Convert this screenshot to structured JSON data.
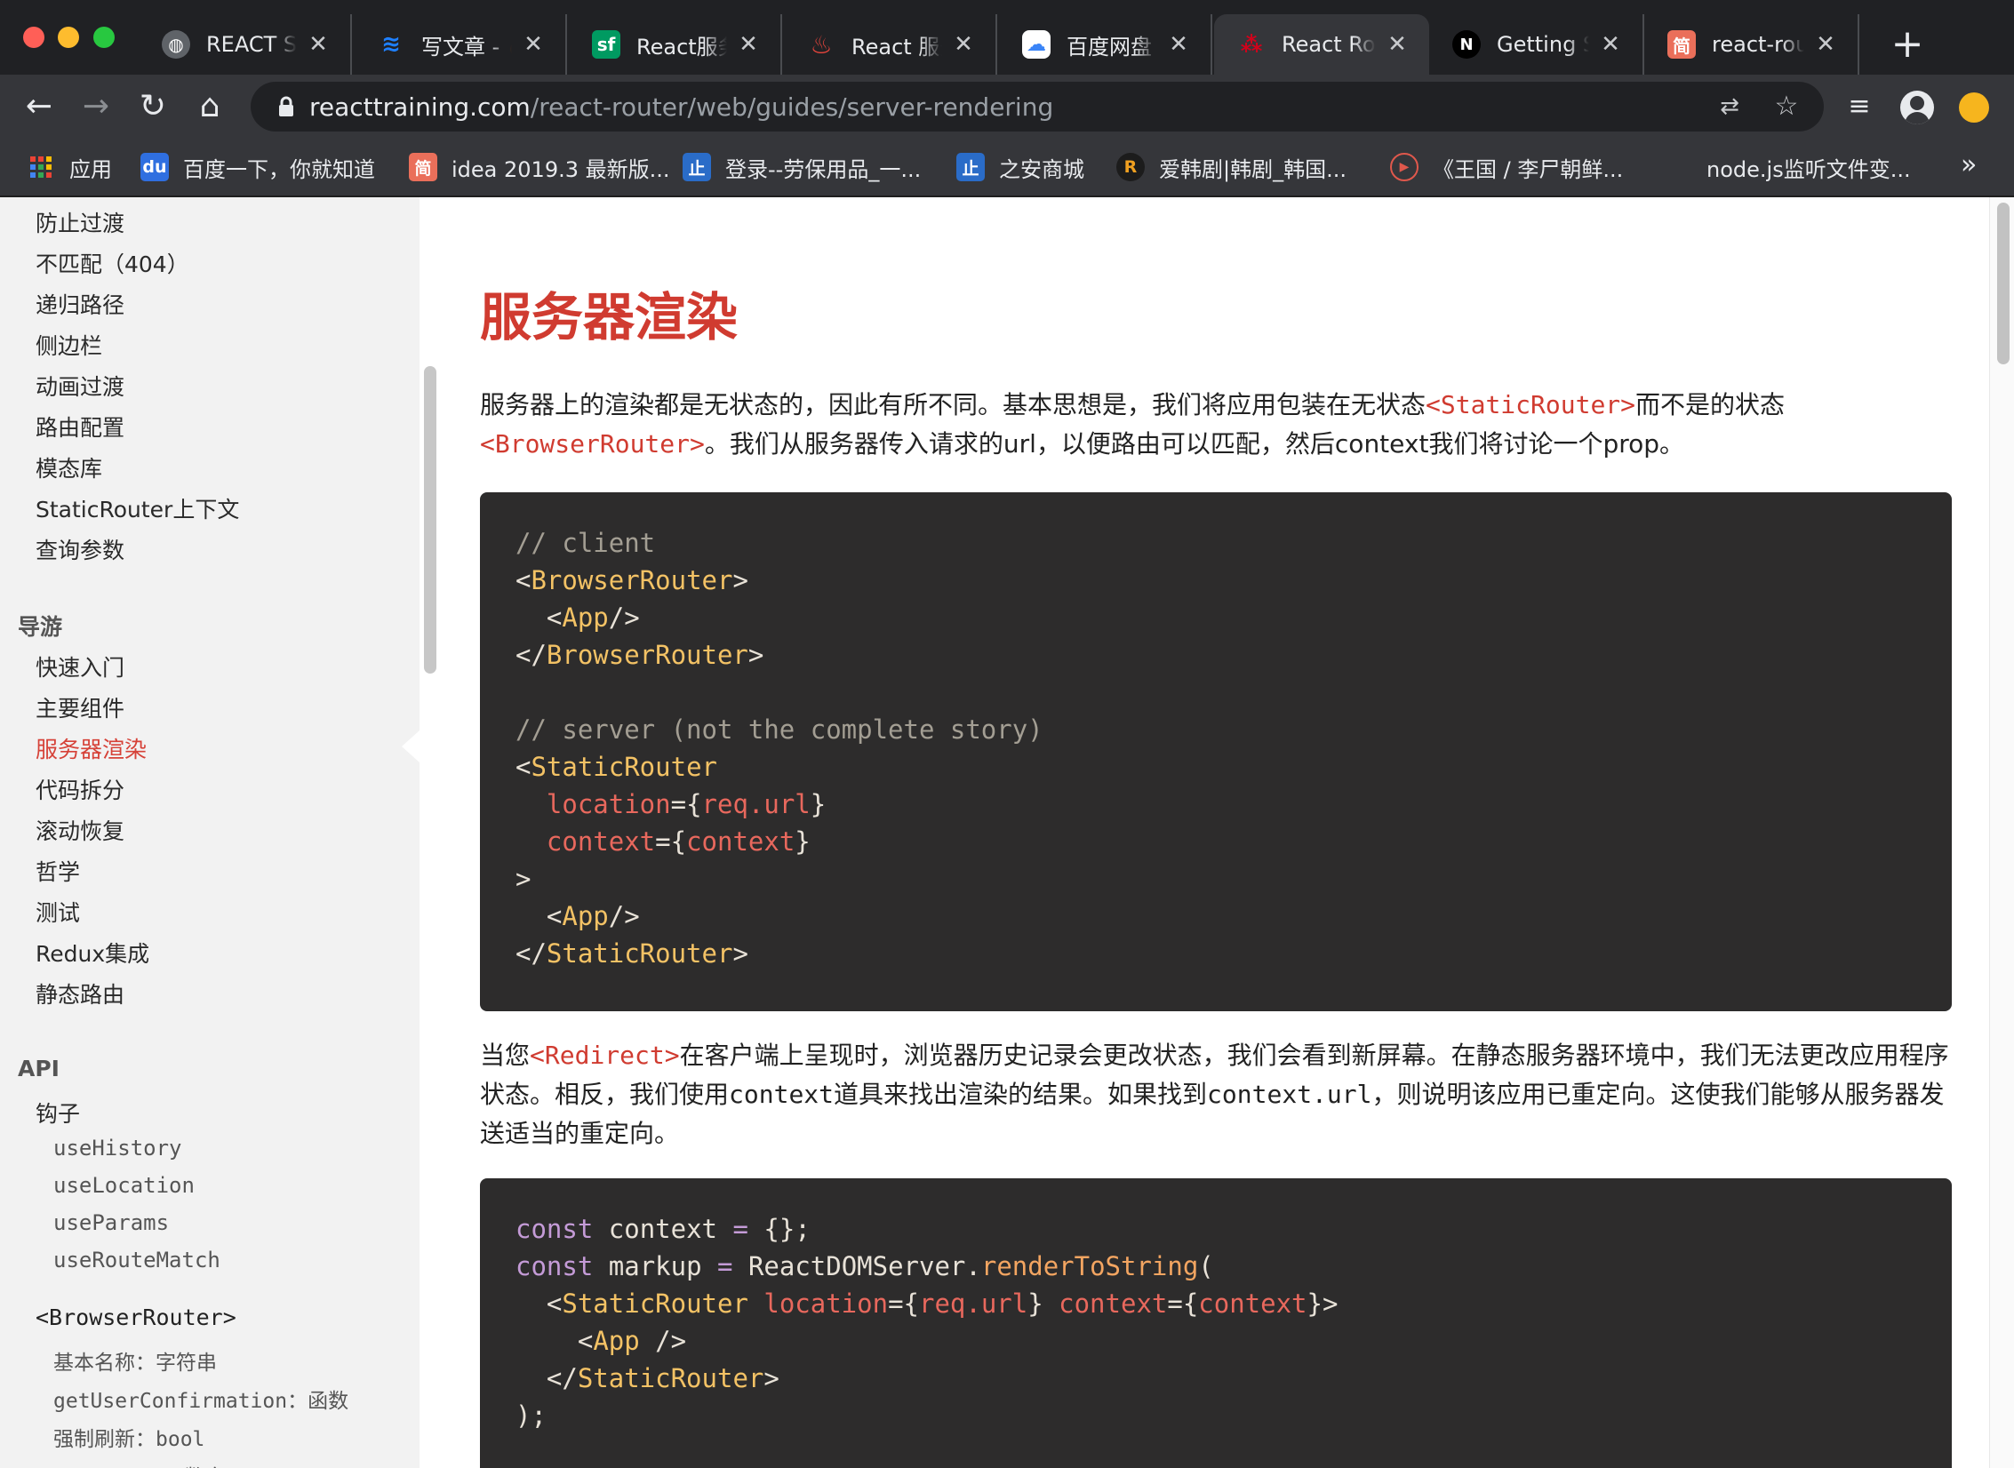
{
  "browser": {
    "tabs": [
      {
        "title": "REACT SSR",
        "favicon": "globe-icon",
        "color": "#5f6368"
      },
      {
        "title": "写文章 - 🔥",
        "favicon": "juejin-icon",
        "color": "#1e80ff"
      },
      {
        "title": "React服务",
        "favicon": "segmentfault-icon",
        "color": "#009a61"
      },
      {
        "title": "React 服务",
        "favicon": "flame-icon",
        "color": "#e8453c"
      },
      {
        "title": "百度网盘 - ",
        "favicon": "baidu-pan-icon",
        "color": "#3a84f7"
      },
      {
        "title": "React Router",
        "favicon": "react-router-icon",
        "color": "#d0021b"
      },
      {
        "title": "Getting Started",
        "favicon": "nextjs-icon",
        "color": "#000000"
      },
      {
        "title": "react-router",
        "favicon": "jianshu-icon",
        "color": "#ea6f5a"
      }
    ],
    "active_tab": 5,
    "url_host": "reacttraining.com",
    "url_path": "/react-router/web/guides/server-rendering",
    "bookmarks": [
      {
        "label": "应用",
        "icon": "apps-grid-icon"
      },
      {
        "label": "百度一下，你就知道",
        "icon": "baidu-paw-icon"
      },
      {
        "label": "idea 2019.3 最新版...",
        "icon": "jianshu-icon"
      },
      {
        "label": "登录--劳保用品_一...",
        "icon": "zhian-icon"
      },
      {
        "label": "之安商城",
        "icon": "zhian-icon"
      },
      {
        "label": "爱韩剧|韩剧_韩国...",
        "icon": "r-icon"
      },
      {
        "label": "《王国 / 李尸朝鲜...",
        "icon": "play-circle-icon"
      },
      {
        "label": "node.js监听文件变...",
        "icon": "none"
      }
    ]
  },
  "sidebar": {
    "items_top": [
      "防止过渡",
      "不匹配（404）",
      "递归路径",
      "侧边栏",
      "动画过渡",
      "路由配置",
      "模态库",
      "StaticRouter上下文",
      "查询参数"
    ],
    "section_guides": "导游",
    "guides": [
      "快速入门",
      "主要组件",
      "服务器渲染",
      "代码拆分",
      "滚动恢复",
      "哲学",
      "测试",
      "Redux集成",
      "静态路由"
    ],
    "active_guide": "服务器渲染",
    "section_api": "API",
    "hooks_label": "钩子",
    "hooks": [
      "useHistory",
      "useLocation",
      "useParams",
      "useRouteMatch"
    ],
    "browser_router": "<BrowserRouter>",
    "props": [
      "基本名称：字符串",
      "getUserConfirmation：函数",
      "强制刷新：bool",
      "keyLength：数字"
    ]
  },
  "content": {
    "title": "服务器渲染",
    "p1": {
      "a": "服务器上的渲染都是无状态的，因此有所不同。基本思想是，我们将应用包装在无状态",
      "tag1": "<StaticRouter>",
      "b": "而不是的状态",
      "tag2": "<BrowserRouter>",
      "c": "。我们从服务器传入请求的url，以便路由可以匹配，然后context我们将讨论一个prop。"
    },
    "p2": {
      "a": "当您",
      "tag": "<Redirect>",
      "b": "在客户端上呈现时，浏览器历史记录会更改状态，我们会看到新屏幕。在静态服务器环境中，我们无法更改应用程序状态。相反，我们使用",
      "m1": "context",
      "c": "道具来找出渲染的结果。如果找到",
      "m2": "context.url",
      "d": "，则说明该应用已重定向。这使我们能够从服务器发送适当的重定向。"
    },
    "code1": {
      "comment1": "// client",
      "browser_router": "BrowserRouter",
      "app": "App",
      "comment2": "// server (not the complete story)",
      "static_router": "StaticRouter",
      "location": "location",
      "req_url": "req.url",
      "context": "context"
    },
    "code2": {
      "const": "const",
      "context_var": "context",
      "markup": "markup",
      "server": "ReactDOMServer",
      "render": "renderToString",
      "static_router": "StaticRouter",
      "location": "location",
      "req_url": "req.url",
      "context_attr": "context",
      "app": "App"
    }
  }
}
